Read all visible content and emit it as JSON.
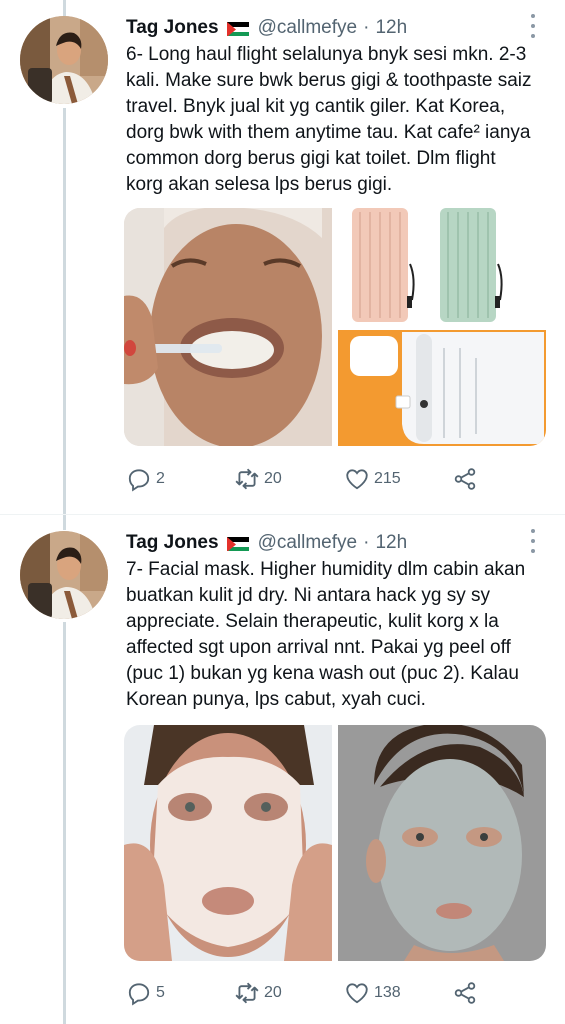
{
  "tweets": [
    {
      "author": {
        "name": "Tag Jones",
        "handle": "@callmefye",
        "dot": "·",
        "time": "12h"
      },
      "lines": [
        "6- Long haul flight selalunya bnyk sesi mkn. 2-3",
        "kali. Make sure bwk berus gigi & toothpaste saiz",
        "travel. Bnyk jual kit yg cantik giler. Kat Korea,",
        "dorg bwk with them anytime tau. Kat cafe² ianya",
        "common dorg berus gigi kat toilet. Dlm flight",
        "korg akan selesa lps berus gigi."
      ],
      "stats": {
        "replies": "2",
        "retweets": "20",
        "likes": "215"
      }
    },
    {
      "author": {
        "name": "Tag Jones",
        "handle": "@callmefye",
        "dot": "·",
        "time": "12h"
      },
      "lines": [
        "7- Facial mask. Higher humidity dlm cabin akan",
        "buatkan kulit jd dry. Ni antara hack yg sy sy",
        "appreciate. Selain therapeutic, kulit korg x la",
        "affected sgt upon arrival nnt. Pakai yg peel off",
        "(puc 1) bukan yg kena wash out (puc 2). Kalau",
        "Korean punya, lps cabut, xyah cuci."
      ],
      "stats": {
        "replies": "5",
        "retweets": "20",
        "likes": "138"
      }
    }
  ],
  "colors": {
    "text": "#0f1419",
    "muted": "#536471",
    "thread": "#cfd9de",
    "icon": "#536471"
  }
}
